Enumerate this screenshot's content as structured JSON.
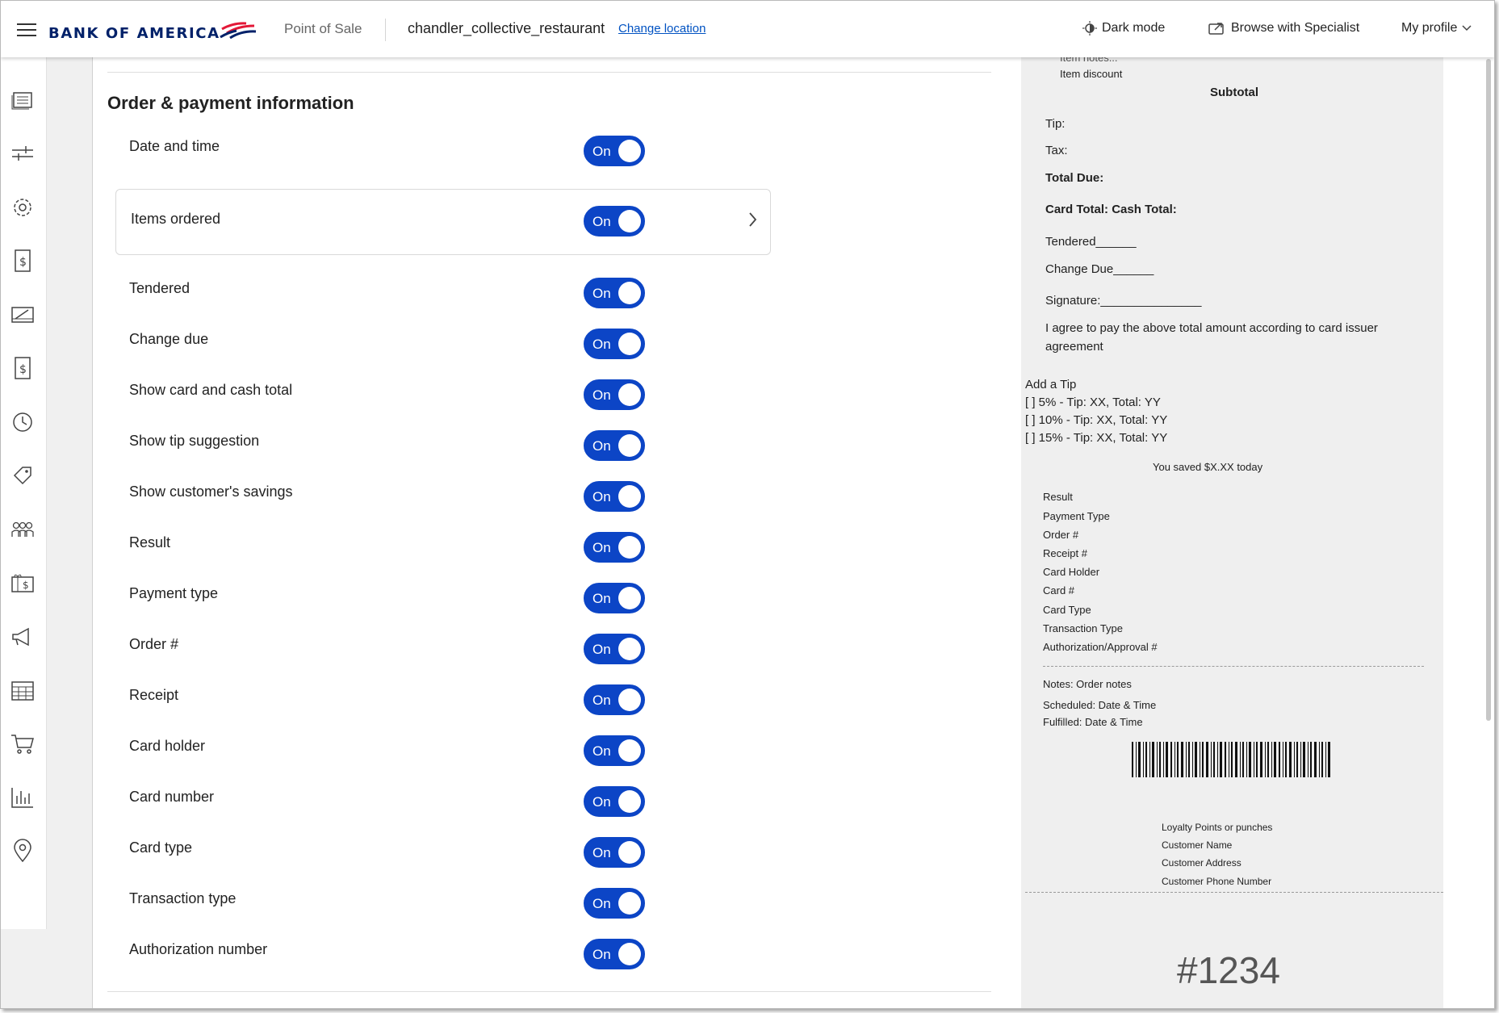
{
  "header": {
    "brand": "BANK OF AMERICA",
    "app_name": "Point of Sale",
    "location": "chandler_collective_restaurant",
    "change_location": "Change location",
    "dark_mode": "Dark mode",
    "browse_specialist": "Browse with Specialist",
    "my_profile": "My profile"
  },
  "rail": {
    "icons": [
      "receipts-icon",
      "sliders-icon",
      "gear-icon",
      "dollar-document-icon",
      "register-icon",
      "dollar-receipt-icon",
      "clock-icon",
      "tag-icon",
      "customers-icon",
      "gift-card-icon",
      "megaphone-icon",
      "calendar-icon",
      "cart-icon",
      "bar-chart-icon",
      "location-pin-icon"
    ]
  },
  "settings": {
    "section_title": "Order & payment information",
    "toggle_on_label": "On",
    "rows": [
      {
        "label": "Date and time",
        "state": "On"
      },
      {
        "label": "Items ordered",
        "state": "On",
        "expandable": true
      },
      {
        "label": "Tendered",
        "state": "On"
      },
      {
        "label": "Change due",
        "state": "On"
      },
      {
        "label": "Show card and cash total",
        "state": "On"
      },
      {
        "label": "Show tip suggestion",
        "state": "On"
      },
      {
        "label": "Show customer's savings",
        "state": "On"
      },
      {
        "label": "Result",
        "state": "On"
      },
      {
        "label": "Payment type",
        "state": "On"
      },
      {
        "label": "Order #",
        "state": "On"
      },
      {
        "label": "Receipt",
        "state": "On"
      },
      {
        "label": "Card holder",
        "state": "On"
      },
      {
        "label": "Card number",
        "state": "On"
      },
      {
        "label": "Card type",
        "state": "On"
      },
      {
        "label": "Transaction type",
        "state": "On"
      },
      {
        "label": "Authorization number",
        "state": "On"
      }
    ]
  },
  "receipt": {
    "item_notes": "Item notes...",
    "item_discount": "Item discount",
    "subtotal": "Subtotal",
    "tip": "Tip:",
    "tax": "Tax:",
    "total_due": "Total Due:",
    "card_cash_total": "Card Total: Cash Total:",
    "tendered": "Tendered______",
    "change_due": "Change Due______",
    "signature": "Signature:_______________",
    "agreement_1": "I agree to pay the above total amount according to card issuer",
    "agreement_2": "agreement",
    "add_tip": "Add a Tip",
    "tip_options": [
      "[  ] 5% - Tip: XX, Total: YY",
      "[  ] 10% - Tip: XX, Total: YY",
      "[  ] 15% - Tip: XX, Total: YY"
    ],
    "savings": "You saved $X.XX today",
    "details": [
      "Result",
      "Payment Type",
      "Order #",
      "Receipt #",
      "Card Holder",
      "Card #",
      "Card Type",
      "Transaction Type",
      "Authorization/Approval #"
    ],
    "notes": "Notes: Order notes",
    "scheduled": "Scheduled: Date & Time",
    "fulfilled": "Fulfilled: Date & Time",
    "loyalty": [
      "Loyalty Points or punches",
      "Customer Name",
      "Customer Address",
      "Customer Phone Number"
    ],
    "order_number": "#1234"
  },
  "colors": {
    "brand_navy": "#012169",
    "brand_red": "#e31837",
    "toggle_blue": "#0c45c6",
    "link_blue": "#0052c2"
  }
}
